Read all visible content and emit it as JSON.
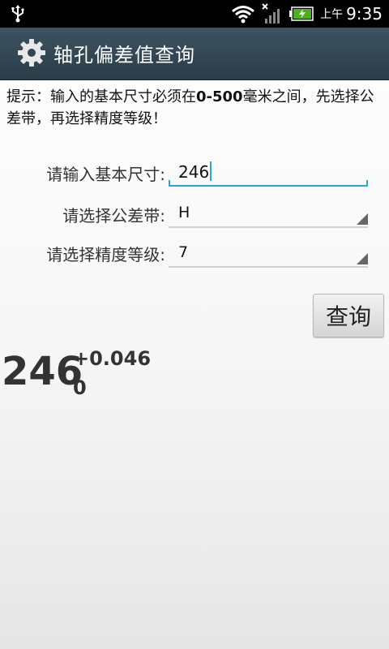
{
  "status_bar": {
    "ampm": "上午",
    "time": "9:35",
    "icons": [
      "usb-icon",
      "wifi-icon",
      "signal-icon",
      "battery-icon"
    ]
  },
  "app": {
    "title": "轴孔偏差值查询",
    "icon": "gear-icon"
  },
  "hint": {
    "prefix": "提示：输入的基本尺寸必须在",
    "range": "0-500",
    "suffix": "毫米之间，先选择公差带，再选择精度等级！"
  },
  "form": {
    "size_label": "请输入基本尺寸:",
    "size_value": "246",
    "tolerance_label": "请选择公差带:",
    "tolerance_value": "H",
    "grade_label": "请选择精度等级:",
    "grade_value": "7",
    "query_label": "查询"
  },
  "result": {
    "base": "246",
    "upper": "+0.046",
    "lower": "0"
  },
  "colors": {
    "title_bar": "#2b3c48",
    "accent": "#2aa3d6"
  }
}
